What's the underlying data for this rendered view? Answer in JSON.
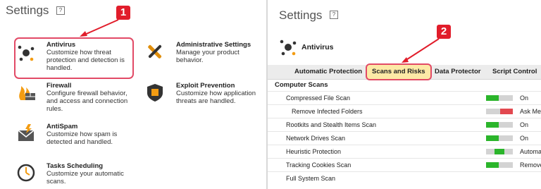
{
  "left": {
    "title": "Settings",
    "help": "?",
    "badge": "1",
    "features": [
      {
        "name": "Antivirus",
        "desc1": "Customize how threat",
        "desc2": "protection and detection is",
        "desc3": "handled.",
        "icon": "antivirus-icon"
      },
      {
        "name": "Administrative Settings",
        "desc1": "Manage your product",
        "desc2": "behavior.",
        "desc3": "",
        "icon": "tools-icon"
      },
      {
        "name": "Firewall",
        "desc1": "Configure firewall behavior,",
        "desc2": "and access and connection",
        "desc3": "rules.",
        "icon": "firewall-icon"
      },
      {
        "name": "Exploit Prevention",
        "desc1": "Customize how application",
        "desc2": "threats are handled.",
        "desc3": "",
        "icon": "shield-icon"
      },
      {
        "name": "AntiSpam",
        "desc1": "Customize how spam is",
        "desc2": "detected and handled.",
        "desc3": "",
        "icon": "antispam-icon"
      },
      {
        "name": "Tasks Scheduling",
        "desc1": "Customize your automatic",
        "desc2": "scans.",
        "desc3": "",
        "icon": "clock-icon"
      }
    ]
  },
  "right": {
    "title": "Settings",
    "help": "?",
    "badge": "2",
    "module": "Antivirus",
    "tabs": [
      "Automatic Protection",
      "Scans and Risks",
      "Data Protector",
      "Script Control"
    ],
    "section": "Computer Scans",
    "rows": [
      {
        "label": "Compressed File Scan",
        "status": "On",
        "toggle": "on"
      },
      {
        "label": "Remove Infected Folders",
        "status": "Ask Me",
        "toggle": "off"
      },
      {
        "label": "Rootkits and Stealth Items Scan",
        "status": "On",
        "toggle": "on"
      },
      {
        "label": "Network Drives Scan",
        "status": "On",
        "toggle": "on"
      },
      {
        "label": "Heuristic Protection",
        "status": "Automa",
        "toggle": "mid"
      },
      {
        "label": "Tracking Cookies Scan",
        "status": "Remove",
        "toggle": "on"
      },
      {
        "label": "Full System Scan",
        "status": "",
        "toggle": "none"
      }
    ],
    "colors": {
      "on": "#2bb52b",
      "off": "#e2484f",
      "toggle_bg": "#d3d3d3"
    }
  }
}
